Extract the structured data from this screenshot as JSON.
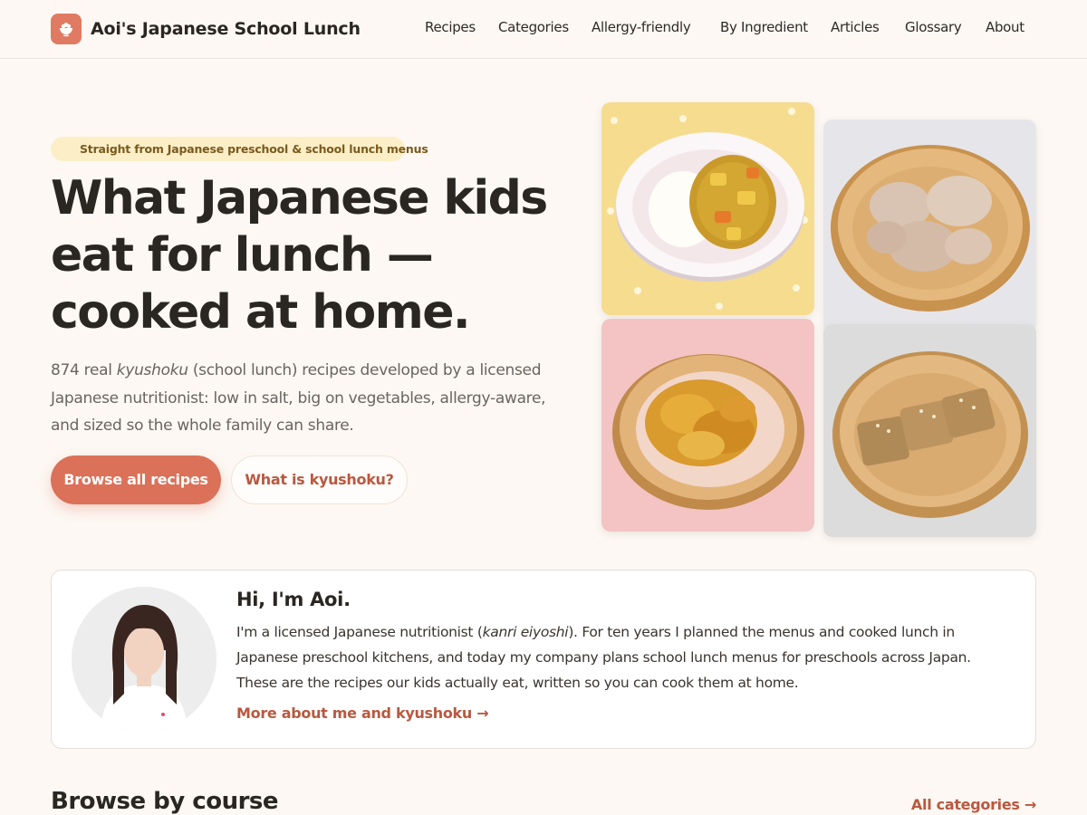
{
  "header": {
    "brand_name": "Aoi's Japanese School Lunch",
    "brand_icon": "rice-bowl-icon",
    "nav": [
      "Recipes",
      "Categories",
      "Allergy-friendly",
      "By Ingredient",
      "Articles",
      "Glossary",
      "About"
    ]
  },
  "hero": {
    "badge": "Straight from Japanese preschool & school lunch menus",
    "title": "What Japanese kids eat for lunch — cooked at home.",
    "subtitle_before": "874 real ",
    "subtitle_italic": "kyushoku",
    "subtitle_after": " (school lunch) recipes developed by a licensed Japanese nutritionist: low in salt, big on vegetables, allergy-aware, and sized so the whole family can share.",
    "primary_button": "Browse all recipes",
    "secondary_button": "What is kyushoku?"
  },
  "about": {
    "title": "Hi, I'm Aoi.",
    "text_before": "I'm a licensed Japanese nutritionist (",
    "text_italic": "kanri eiyoshi",
    "text_after": "). For ten years I planned the menus and cooked lunch in Japanese preschool kitchens, and today my company plans school lunch menus for preschools across Japan. These are the recipes our kids actually eat, written so you can cook them at home.",
    "link": "More about me and kyushoku →"
  },
  "section": {
    "title": "Browse by course",
    "link": "All categories →"
  },
  "colors": {
    "accent": "#db7159",
    "accent_text": "#b9583f",
    "background": "#fdf8f3",
    "badge_bg": "#fcefc8"
  }
}
